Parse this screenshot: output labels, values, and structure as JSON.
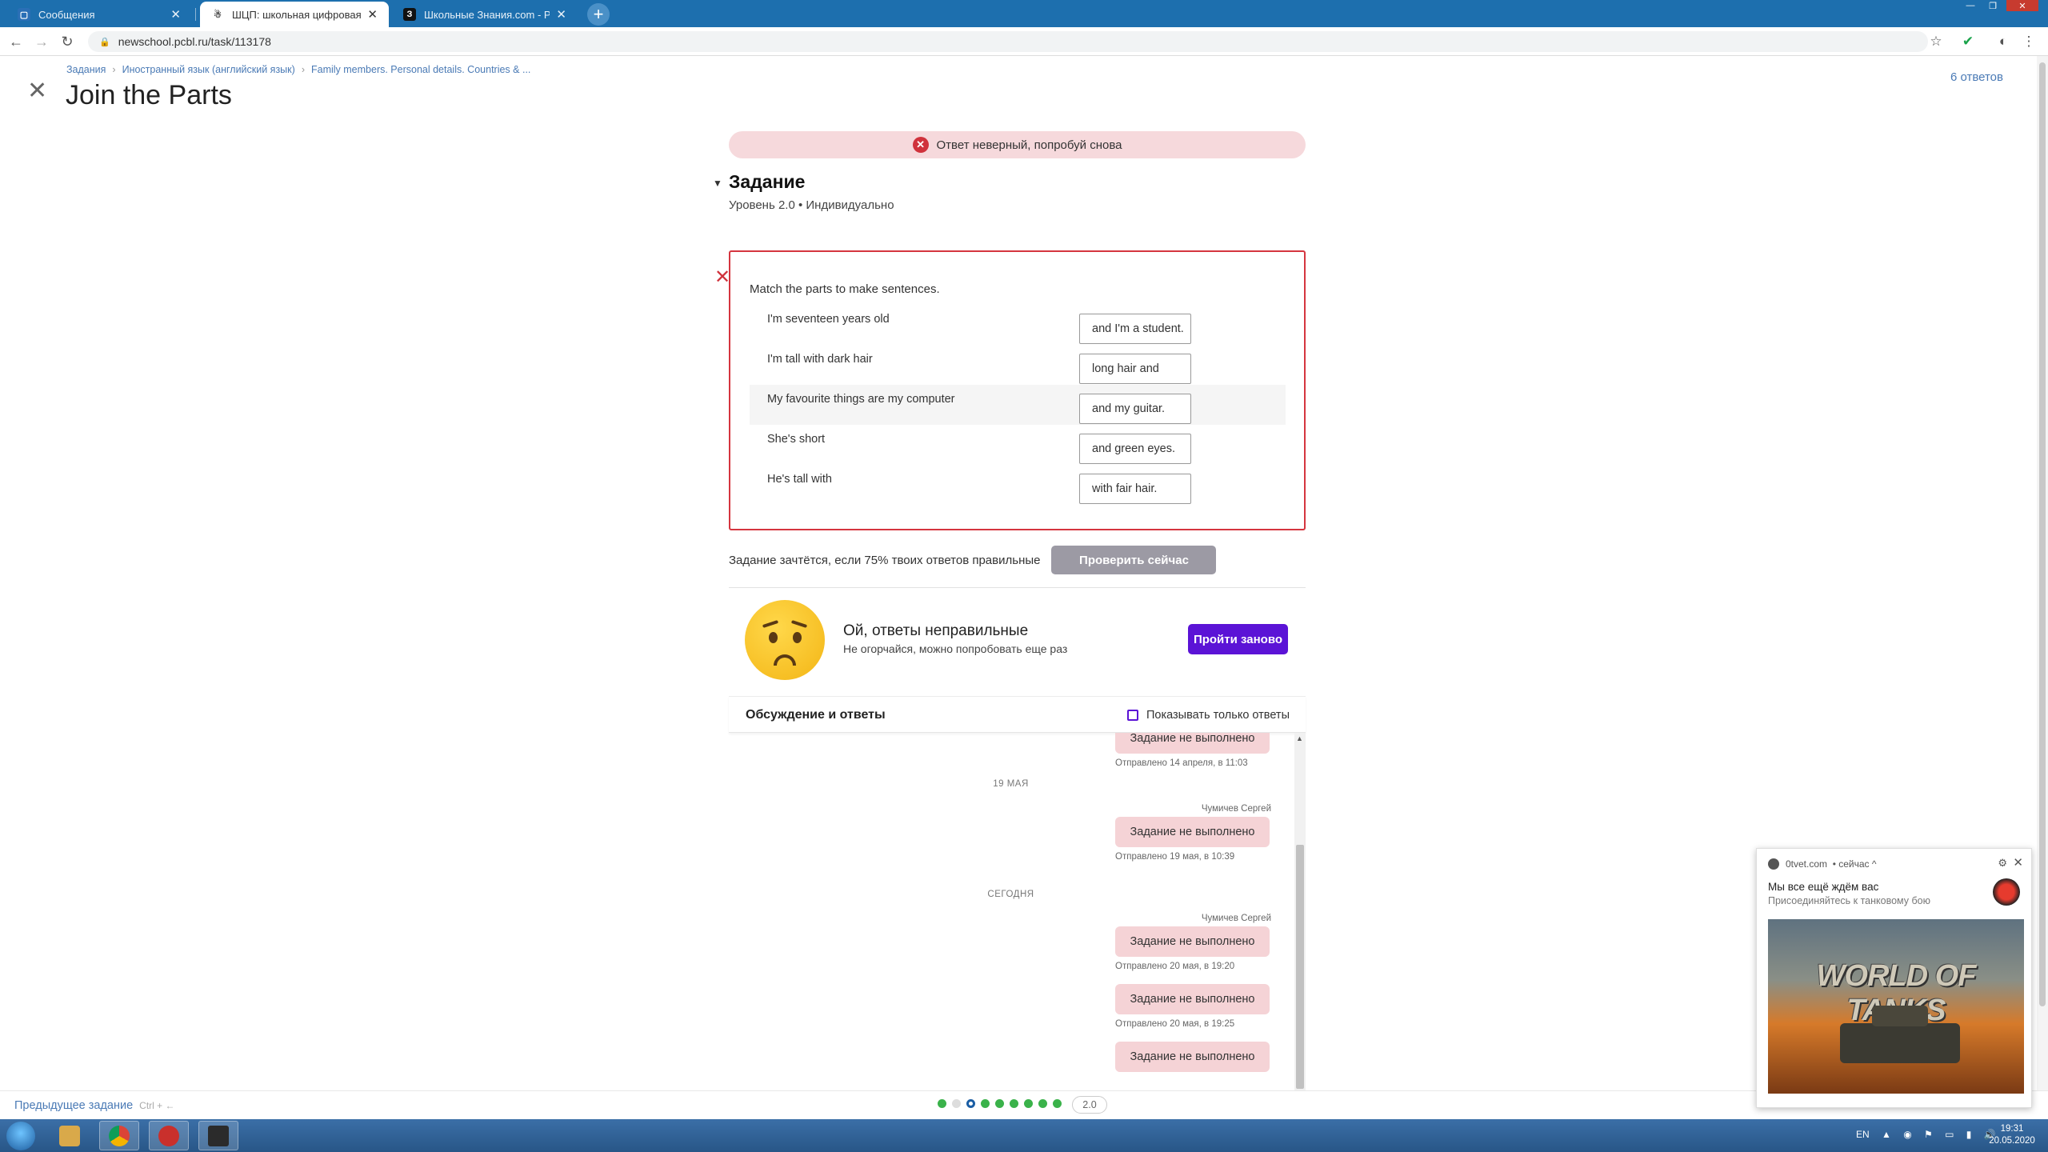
{
  "browser": {
    "tabs": [
      {
        "title": "Сообщения",
        "favicon_color": "#2a6fb6",
        "favicon_glyph": "▢",
        "active": false
      },
      {
        "title": "ШЦП: школьная цифровая пла",
        "favicon_color": "#ffffff",
        "favicon_glyph": "☃",
        "active": true
      },
      {
        "title": "Школьные Знания.com - Решае",
        "favicon_color": "#111111",
        "favicon_glyph": "З",
        "active": false
      }
    ],
    "url": "newschool.pcbl.ru/task/113178"
  },
  "page": {
    "breadcrumb": [
      "Задания",
      "Иностранный язык (английский язык)",
      "Family members. Personal details. Countries & ..."
    ],
    "title": "Join the Parts",
    "answers_count": "6 ответов",
    "error_banner": "Ответ неверный, попробуй снова",
    "task_heading": "Задание",
    "task_meta": "Уровень 2.0 • Индивидуально",
    "instruction": "Match the parts to make sentences.",
    "pairs": [
      {
        "left": "I'm seventeen years old",
        "right": "and I'm a student."
      },
      {
        "left": "I'm tall with dark hair",
        "right": "long hair and"
      },
      {
        "left": "My favourite things are my computer",
        "right": "and my guitar."
      },
      {
        "left": "She's short",
        "right": "and green eyes."
      },
      {
        "left": "He's tall with",
        "right": "with fair hair."
      }
    ],
    "credit_text": "Задание зачтётся, если 75% твоих ответов правильные",
    "check_button": "Проверить сейчас",
    "result_title": "Ой, ответы неправильные",
    "result_sub": "Не огорчайся, можно попробовать еще раз",
    "retry_button": "Пройти заново",
    "discussion_title": "Обсуждение и ответы",
    "discussion_filter": "Показывать только ответы",
    "chat": {
      "bubble_text": "Задание не выполнено",
      "sent_1": "Отправлено 14 апреля, в 11:03",
      "day_1": "19 МАЯ",
      "author_1": "Чумичев Сергей",
      "sent_2": "Отправлено 19 мая, в 10:39",
      "day_2": "СЕГОДНЯ",
      "author_2": "Чумичев Сергей",
      "sent_3": "Отправлено 20 мая, в 19:20",
      "sent_4": "Отправлено 20 мая, в 19:25"
    },
    "prev_task": "Предыдущее задание",
    "prev_hint": "Ctrl + ←",
    "level_badge": "2.0",
    "progress_dots": [
      "done",
      "empty",
      "current",
      "done",
      "done",
      "done",
      "done",
      "done",
      "done"
    ]
  },
  "notification": {
    "source": "0tvet.com",
    "time": "• сейчас ^",
    "title": "Мы все ещё ждём вас",
    "body": "Присоединяйтесь к танковому бою",
    "image_text": "WORLD OF TANKS"
  },
  "taskbar": {
    "lang": "EN",
    "time": "19:31",
    "date": "20.05.2020"
  },
  "colors": {
    "accent": "#5b13d6",
    "error": "#d5353f",
    "link": "#4a7ab5",
    "progress_done": "#3ab24a"
  }
}
